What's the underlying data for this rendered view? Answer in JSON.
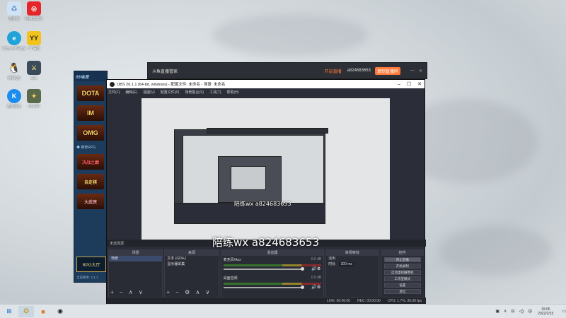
{
  "desktop": {
    "icons": [
      {
        "label": "回收站",
        "icon": "recycle-bin-icon"
      },
      {
        "label": "网易云音乐",
        "icon": "netease-music-icon"
      },
      {
        "label": "Microsoft Edge",
        "icon": "edge-icon"
      },
      {
        "label": "YY语音",
        "icon": "yy-icon"
      },
      {
        "label": "腾讯QQ",
        "icon": "qq-icon"
      },
      {
        "label": "LOL",
        "icon": "game-icon"
      },
      {
        "label": "酷狗音乐",
        "icon": "kugou-icon"
      },
      {
        "label": "CS:GO",
        "icon": "csgo-icon"
      }
    ]
  },
  "game_client": {
    "brand": "09电竞",
    "games": [
      "DOTA",
      "IM",
      "OMG"
    ],
    "section_label": "◆ 推荐RPG",
    "games2": [
      "决战之巅",
      "自走棋",
      "大武侠"
    ],
    "rpg_button": "RPG大厅",
    "version": "当前版本: 2.1.1"
  },
  "douyu": {
    "title": "斗鱼直播管家",
    "live_label": "开启直播",
    "user_id": "a824683653",
    "button_label": "复制直播码"
  },
  "obs": {
    "title": "OBS 26.1.1 (64-bit, windows) - 配置文件: 未命名 - 场景: 未命名",
    "menu": [
      "文件(F)",
      "编辑(E)",
      "视图(V)",
      "配置文件(P)",
      "场景集合(S)",
      "工具(T)",
      "帮助(H)"
    ],
    "dock_bar_text": "未选择源",
    "scenes": {
      "header": "场景",
      "items": [
        "场景"
      ]
    },
    "sources": {
      "header": "来源",
      "items": [
        "文本 (GDI+)",
        "显示器采集"
      ]
    },
    "mixer": {
      "header": "混音器",
      "channels": [
        {
          "name": "麦克风/Aux",
          "db": "0.0 dB"
        },
        {
          "name": "桌面音频",
          "db": "0.0 dB"
        }
      ]
    },
    "transitions": {
      "header": "转场特效",
      "type": "淡出",
      "duration_label": "时长",
      "duration": "300 ms"
    },
    "controls": {
      "header": "控件",
      "buttons": [
        "停止直播",
        "开始录制",
        "启动虚拟摄像机",
        "工作室模式",
        "设置",
        "退出"
      ]
    },
    "status": {
      "live": "LIVE: 00:00:00",
      "rec": "REC: 00:00:00",
      "cpu": "CPU: 1.7%, 30.00 fps"
    }
  },
  "overlay": {
    "text": "陪练wx a824683653",
    "small_text": "陪练wx a824683653"
  },
  "taskbar": {
    "time": "19:06",
    "date": "2022/2/15",
    "ime": "中"
  },
  "colors": {
    "obs_bg": "#2b2e38",
    "accent": "#ff7a3a"
  }
}
